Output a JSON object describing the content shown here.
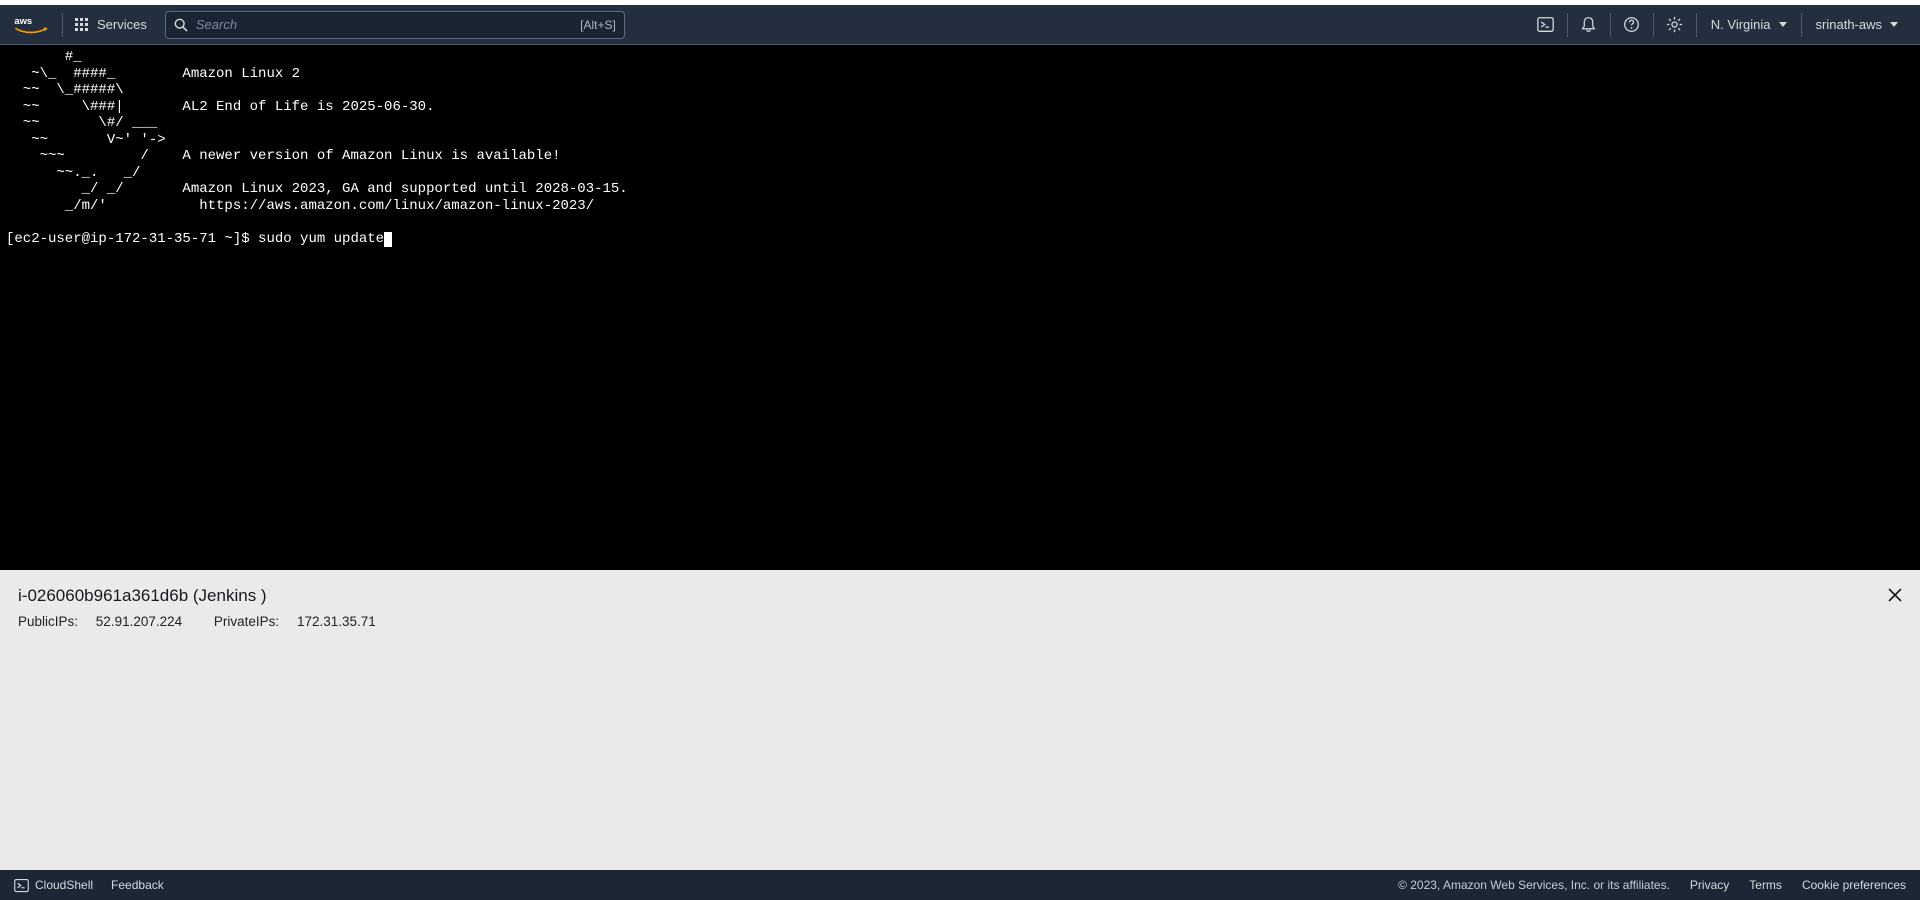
{
  "nav": {
    "logo_text": "aws",
    "services_label": "Services",
    "search_placeholder": "Search",
    "search_shortcut": "[Alt+S]",
    "region_label": "N. Virginia",
    "account_label": "srinath-aws"
  },
  "terminal": {
    "motd": [
      "       #_",
      "   ~\\_  ####_        Amazon Linux 2",
      "  ~~  \\_#####\\",
      "  ~~     \\###|       AL2 End of Life is 2025-06-30.",
      "  ~~       \\#/ ___",
      "   ~~       V~' '->",
      "    ~~~         /    A newer version of Amazon Linux is available!",
      "      ~~._.   _/",
      "         _/ _/       Amazon Linux 2023, GA and supported until 2028-03-15.",
      "       _/m/'           https://aws.amazon.com/linux/amazon-linux-2023/",
      ""
    ],
    "prompt": "[ec2-user@ip-172-31-35-71 ~]$ ",
    "command": "sudo yum update"
  },
  "instance": {
    "title": "i-026060b961a361d6b (Jenkins )",
    "public_label": "PublicIPs:",
    "public_ip": "52.91.207.224",
    "private_label": "PrivateIPs:",
    "private_ip": "172.31.35.71"
  },
  "footer": {
    "cloudshell_label": "CloudShell",
    "feedback_label": "Feedback",
    "copyright": "© 2023, Amazon Web Services, Inc. or its affiliates.",
    "privacy": "Privacy",
    "terms": "Terms",
    "cookies": "Cookie preferences"
  }
}
